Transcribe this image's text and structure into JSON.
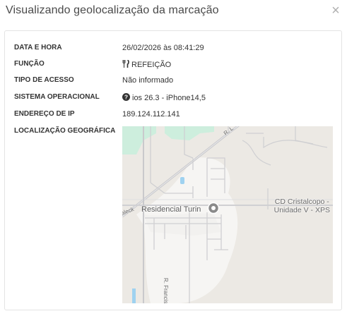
{
  "modal": {
    "title": "Visualizando geolocalização da marcação",
    "close_symbol": "×"
  },
  "details": [
    {
      "label": "DATA E HORA",
      "value": "26/02/2026 às 08:41:29"
    },
    {
      "label": "FUNÇÃO",
      "value": "REFEIÇÃO",
      "icon": "fork-knife-icon"
    },
    {
      "label": "TIPO DE ACESSO",
      "value": "Não informado"
    },
    {
      "label": "SISTEMA OPERACIONAL",
      "value": "ios 26.3 - iPhone14,5",
      "icon": "question-circle-icon"
    },
    {
      "label": "ENDEREÇO DE IP",
      "value": "189.124.112.141"
    },
    {
      "label": "LOCALIZAÇÃO GEOGRÁFICA",
      "value": ""
    }
  ],
  "map": {
    "place_label": "Residencial Turin",
    "poi_label_line1": "CD Cristalcopo -",
    "poi_label_line2": "Unidade V - XPS",
    "street_top": "R. L",
    "street_left": "aleck",
    "street_vertical": "R. Francisco Bu",
    "colors": {
      "land": "#ece9e4",
      "residential": "#f6f5f3",
      "park": "#cdeedd",
      "road": "#c9c9cc",
      "road_light": "#ffffff",
      "water": "#9fd2f0",
      "pin": "#8a8a8a"
    }
  }
}
